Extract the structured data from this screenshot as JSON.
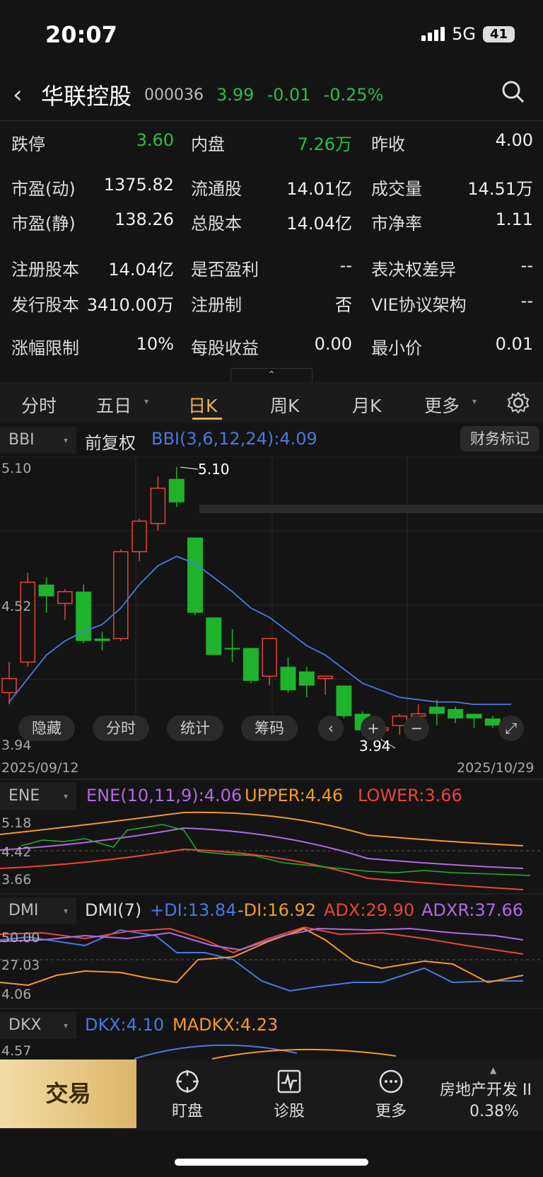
{
  "status": {
    "time": "20:07",
    "network": "5G",
    "battery": "41"
  },
  "header": {
    "name": "华联控股",
    "code": "000036",
    "price": "3.99",
    "change": "-0.01",
    "pct": "-0.25%"
  },
  "info": {
    "r1": [
      {
        "k": "跌停",
        "v": "3.60"
      },
      {
        "k": "内盘",
        "v": "7.26万"
      },
      {
        "k": "昨收",
        "v": "4.00"
      }
    ],
    "r2": [
      {
        "k": "市盈(动)",
        "v": "1375.82"
      },
      {
        "k": "流通股",
        "v": "14.01亿"
      },
      {
        "k": "成交量",
        "v": "14.51万"
      }
    ],
    "r3": [
      {
        "k": "市盈(静)",
        "v": "138.26"
      },
      {
        "k": "总股本",
        "v": "14.04亿"
      },
      {
        "k": "市净率",
        "v": "1.11"
      }
    ],
    "r4": [
      {
        "k": "注册股本",
        "v": "14.04亿"
      },
      {
        "k": "是否盈利",
        "v": "--"
      },
      {
        "k": "表决权差异",
        "v": "--"
      }
    ],
    "r5": [
      {
        "k": "发行股本",
        "v": "3410.00万"
      },
      {
        "k": "注册制",
        "v": "否"
      },
      {
        "k": "VIE协议架构",
        "v": "--"
      }
    ],
    "r6": [
      {
        "k": "涨幅限制",
        "v": "10%"
      },
      {
        "k": "每股收益",
        "v": "0.00"
      },
      {
        "k": "最小价",
        "v": "0.01"
      }
    ]
  },
  "tabs": [
    "分时",
    "五日",
    "日K",
    "周K",
    "月K",
    "更多"
  ],
  "main_panel": {
    "indicator": "BBI",
    "adjust": "前复权",
    "formula": "BBI(3,6,12,24):4.09",
    "finance": "财务标记",
    "ymax": "5.10",
    "ymid": "4.52",
    "ymin": "3.94",
    "high_label": "5.10",
    "low_label": "3.94",
    "date_start": "2025/09/12",
    "date_end": "2025/10/29",
    "pills": [
      "隐藏",
      "分时",
      "统计",
      "筹码"
    ]
  },
  "ene_panel": {
    "indicator": "ENE",
    "formula": "ENE(10,11,9):4.06",
    "upper": "UPPER:4.46",
    "lower": "LOWER:3.66",
    "y1": "5.18",
    "y2": "4.42",
    "y3": "3.66"
  },
  "dmi_panel": {
    "indicator": "DMI",
    "formula": "DMI(7)",
    "pdi": "+DI:13.84",
    "mdi": "-DI:16.92",
    "adx": "ADX:29.90",
    "adxr": "ADXR:37.66",
    "y1": "50.00",
    "y2": "27.03",
    "y3": "4.06"
  },
  "dkx_panel": {
    "indicator": "DKX",
    "dkx": "DKX:4.10",
    "madkx": "MADKX:4.23",
    "y1": "4.57"
  },
  "colors": {
    "up": "#e9443a",
    "down": "#1fb32b",
    "bbi": "#4a78e0",
    "ene_upper": "#f39a2c",
    "ene_mid": "#b06be0",
    "ene_lower": "#e9443a",
    "accent": "#e8b35a"
  },
  "bottom": {
    "trade": "交易",
    "nav": [
      "盯盘",
      "诊股",
      "更多"
    ],
    "sector": "房地产开发 II",
    "sector_pct": "0.38%"
  },
  "chart_data": {
    "type": "candlestick",
    "x_start": "2025/09/12",
    "x_end": "2025/10/29",
    "ylim": [
      3.94,
      5.1
    ],
    "candles": [
      {
        "o": 4.14,
        "h": 4.27,
        "l": 4.09,
        "c": 4.2,
        "up": true
      },
      {
        "o": 4.27,
        "h": 4.65,
        "l": 4.25,
        "c": 4.61,
        "up": true
      },
      {
        "o": 4.6,
        "h": 4.63,
        "l": 4.48,
        "c": 4.55,
        "up": false
      },
      {
        "o": 4.52,
        "h": 4.58,
        "l": 4.45,
        "c": 4.57,
        "up": true
      },
      {
        "o": 4.57,
        "h": 4.6,
        "l": 4.35,
        "c": 4.36,
        "up": false
      },
      {
        "o": 4.37,
        "h": 4.4,
        "l": 4.32,
        "c": 4.36,
        "up": false
      },
      {
        "o": 4.37,
        "h": 4.75,
        "l": 4.36,
        "c": 4.74,
        "up": true
      },
      {
        "o": 4.74,
        "h": 4.88,
        "l": 4.7,
        "c": 4.87,
        "up": true
      },
      {
        "o": 4.86,
        "h": 5.06,
        "l": 4.83,
        "c": 5.01,
        "up": true
      },
      {
        "o": 5.05,
        "h": 5.1,
        "l": 4.93,
        "c": 4.95,
        "up": false
      },
      {
        "o": 4.8,
        "h": 4.8,
        "l": 4.47,
        "c": 4.48,
        "up": false
      },
      {
        "o": 4.46,
        "h": 4.46,
        "l": 4.3,
        "c": 4.3,
        "up": false
      },
      {
        "o": 4.33,
        "h": 4.41,
        "l": 4.27,
        "c": 4.33,
        "up": false
      },
      {
        "o": 4.33,
        "h": 4.33,
        "l": 4.18,
        "c": 4.19,
        "up": false
      },
      {
        "o": 4.21,
        "h": 4.36,
        "l": 4.17,
        "c": 4.37,
        "up": true
      },
      {
        "o": 4.25,
        "h": 4.29,
        "l": 4.14,
        "c": 4.15,
        "up": false
      },
      {
        "o": 4.23,
        "h": 4.25,
        "l": 4.12,
        "c": 4.17,
        "up": false
      },
      {
        "o": 4.21,
        "h": 4.21,
        "l": 4.13,
        "c": 4.2,
        "up": true
      },
      {
        "o": 4.17,
        "h": 4.17,
        "l": 4.03,
        "c": 4.04,
        "up": false
      },
      {
        "o": 4.05,
        "h": 4.06,
        "l": 3.98,
        "c": 3.98,
        "up": false
      },
      {
        "o": 3.98,
        "h": 4.03,
        "l": 3.94,
        "c": 3.99,
        "up": true
      },
      {
        "o": 4.0,
        "h": 4.05,
        "l": 3.96,
        "c": 4.04,
        "up": true
      },
      {
        "o": 4.04,
        "h": 4.09,
        "l": 4.01,
        "c": 4.05,
        "up": true
      },
      {
        "o": 4.08,
        "h": 4.11,
        "l": 4.0,
        "c": 4.05,
        "up": false
      },
      {
        "o": 4.07,
        "h": 4.08,
        "l": 4.01,
        "c": 4.03,
        "up": false
      },
      {
        "o": 4.05,
        "h": 4.05,
        "l": 3.99,
        "c": 4.03,
        "up": false
      },
      {
        "o": 4.03,
        "h": 4.04,
        "l": 3.99,
        "c": 4.0,
        "up": false
      },
      {
        "o": 4.0,
        "h": 4.02,
        "l": 3.94,
        "c": 3.99,
        "up": false
      }
    ],
    "bbi": [
      4.1,
      4.2,
      4.3,
      4.36,
      4.4,
      4.43,
      4.5,
      4.6,
      4.68,
      4.72,
      4.69,
      4.63,
      4.57,
      4.5,
      4.46,
      4.4,
      4.34,
      4.3,
      4.24,
      4.18,
      4.15,
      4.12,
      4.11,
      4.1,
      4.1,
      4.09,
      4.09,
      4.09
    ]
  }
}
